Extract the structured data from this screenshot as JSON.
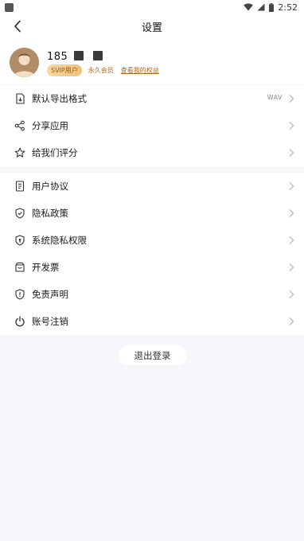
{
  "status_bar": {
    "time": "2:52"
  },
  "header": {
    "title": "设置"
  },
  "profile": {
    "phone_prefix": "185",
    "svip_badge": "SVIP用户",
    "membership": "永久会员",
    "rights_link": "查看我的权益"
  },
  "group1": [
    {
      "label": "默认导出格式",
      "value": "WAV",
      "icon": "export-file-icon"
    },
    {
      "label": "分享应用",
      "value": "",
      "icon": "share-icon"
    },
    {
      "label": "给我们评分",
      "value": "",
      "icon": "star-icon"
    }
  ],
  "group2": [
    {
      "label": "用户协议",
      "icon": "agreement-icon"
    },
    {
      "label": "隐私政策",
      "icon": "shield-check-icon"
    },
    {
      "label": "系统隐私权限",
      "icon": "shield-lock-icon"
    },
    {
      "label": "开发票",
      "icon": "invoice-icon"
    },
    {
      "label": "免责声明",
      "icon": "shield-alert-icon"
    },
    {
      "label": "账号注销",
      "icon": "power-icon"
    }
  ],
  "logout_label": "退出登录",
  "colors": {
    "background": "#f6f6fb",
    "svip_gold": "#f2c17a",
    "member_text": "#a66a1e"
  }
}
